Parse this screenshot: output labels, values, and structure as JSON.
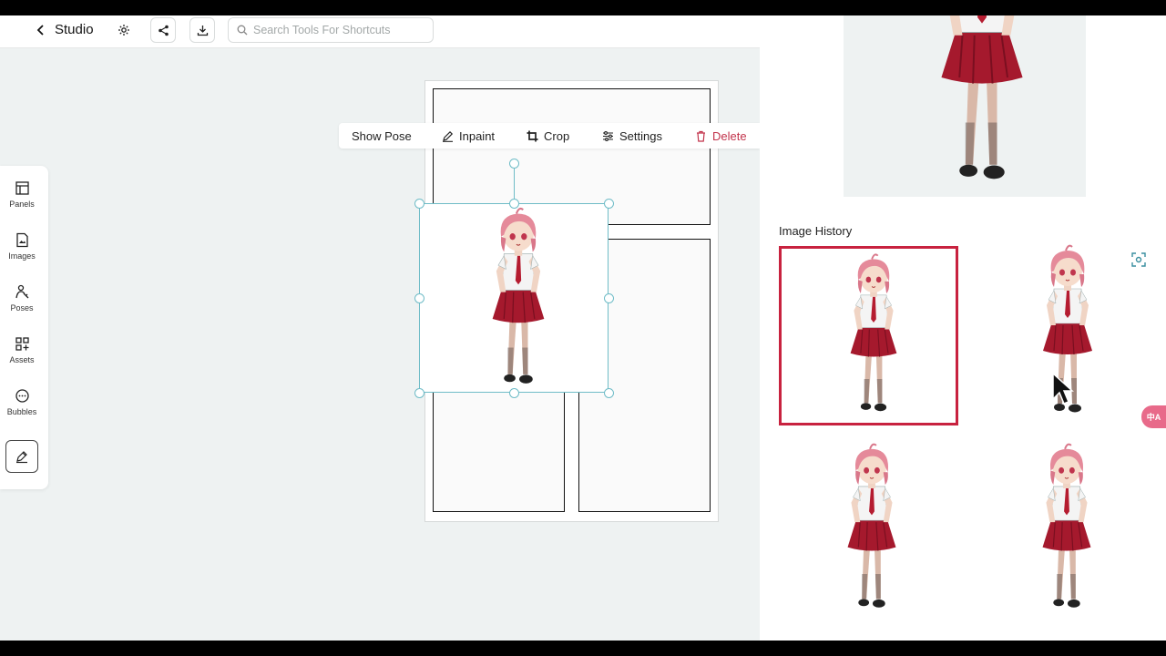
{
  "header": {
    "back_label": "Studio",
    "search_placeholder": "Search Tools For Shortcuts"
  },
  "sidebar": {
    "items": [
      {
        "label": "Panels",
        "icon": "panels-icon"
      },
      {
        "label": "Images",
        "icon": "image-file-icon"
      },
      {
        "label": "Poses",
        "icon": "pose-icon"
      },
      {
        "label": "Assets",
        "icon": "assets-icon"
      },
      {
        "label": "Bubbles",
        "icon": "speech-bubble-icon"
      }
    ]
  },
  "context_toolbar": {
    "show_pose": "Show Pose",
    "inpaint": "Inpaint",
    "crop": "Crop",
    "settings": "Settings",
    "delete": "Delete"
  },
  "right_panel": {
    "history_title": "Image History",
    "translate_glyph": "中A"
  },
  "colors": {
    "accent_selection": "#6fbcc7",
    "active_thumb_border": "#c8223f",
    "delete_text": "#c2334b",
    "skirt": "#a5192d",
    "hair": "#e58a9a"
  }
}
